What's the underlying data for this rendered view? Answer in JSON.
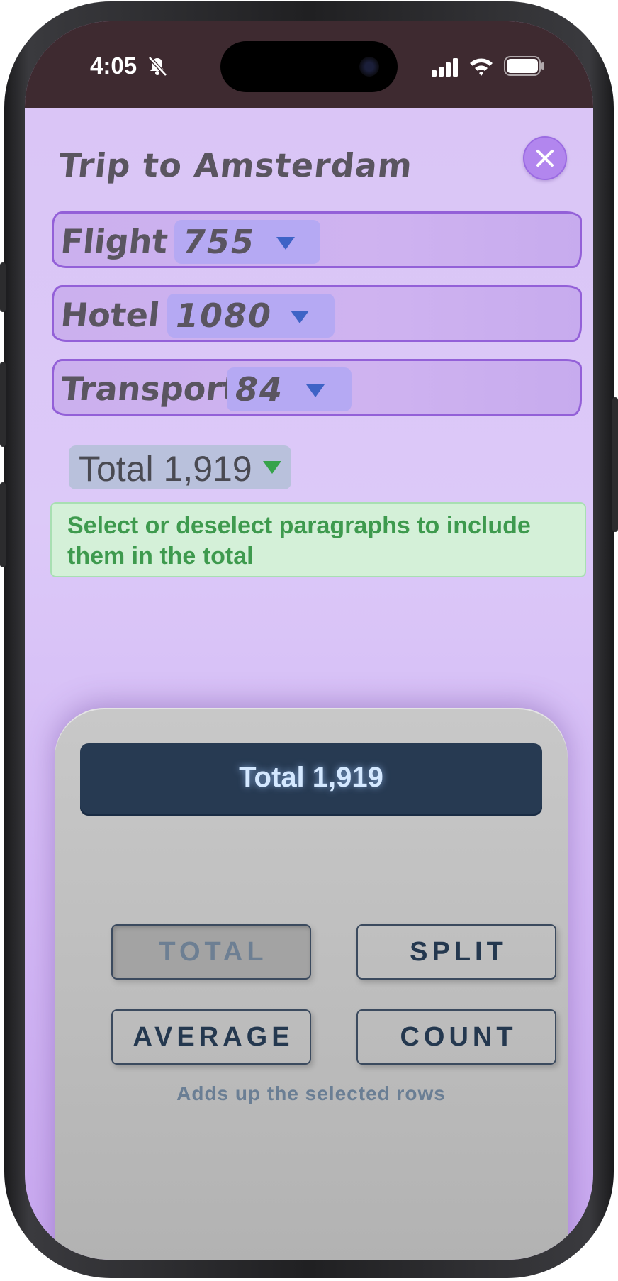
{
  "status_bar": {
    "time": "4:05",
    "icons": [
      "bell-slash-icon",
      "cellular-signal-icon",
      "wifi-icon",
      "battery-icon"
    ]
  },
  "document": {
    "title": "Trip to Amsterdam",
    "close_icon": "close-icon",
    "rows": [
      {
        "label": "Flight",
        "value": "755"
      },
      {
        "label": "Hotel",
        "value": "1080"
      },
      {
        "label": "Transport",
        "value": "84"
      }
    ],
    "total_chip": "Total 1,919",
    "hint": "Select or deselect paragraphs to include them in the total"
  },
  "calculator": {
    "display": "Total 1,919",
    "buttons": {
      "total": "TOTAL",
      "split": "SPLIT",
      "average": "AVERAGE",
      "count": "COUNT"
    },
    "selected_mode": "TOTAL",
    "description": "Adds up the selected rows"
  },
  "colors": {
    "background": "#dcc9f8",
    "status_bar": "#3e2a30",
    "row_border": "#9360d8",
    "value_chip": "#b5a9f3",
    "hint_text": "#3e9a4e",
    "display_bg": "#273a52",
    "button_text": "#24384f"
  }
}
